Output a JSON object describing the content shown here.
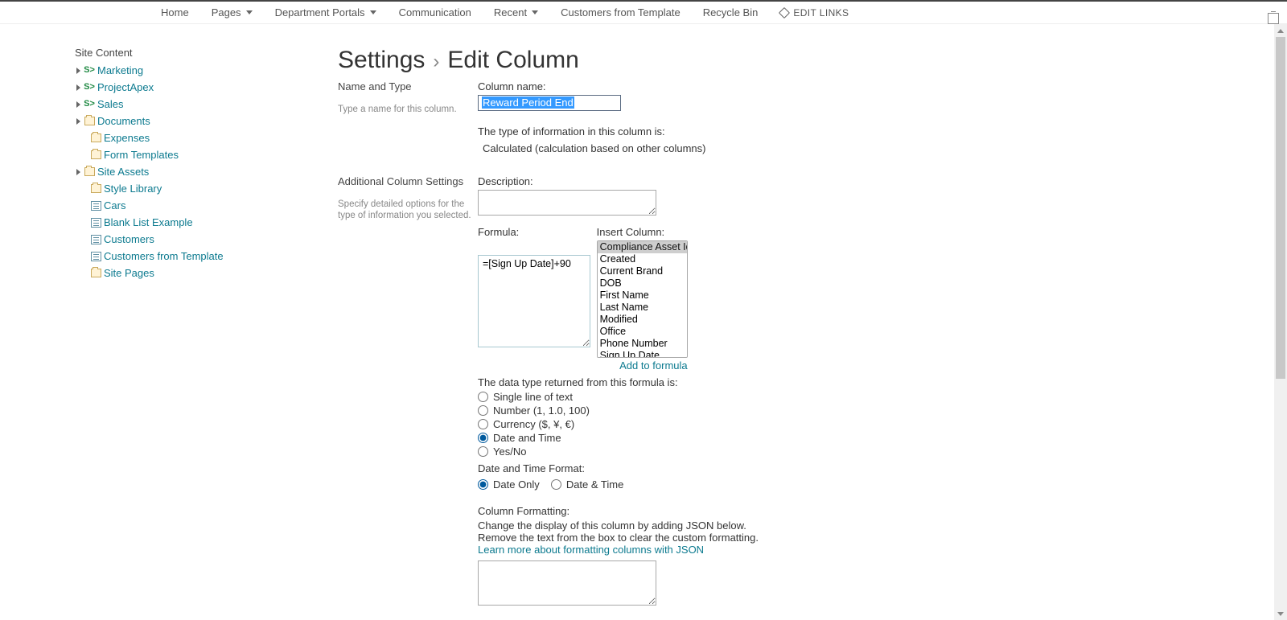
{
  "topnav": {
    "items": [
      {
        "label": "Home",
        "dropdown": false
      },
      {
        "label": "Pages",
        "dropdown": true
      },
      {
        "label": "Department Portals",
        "dropdown": true
      },
      {
        "label": "Communication",
        "dropdown": false
      },
      {
        "label": "Recent",
        "dropdown": true
      },
      {
        "label": "Customers from Template",
        "dropdown": false
      },
      {
        "label": "Recycle Bin",
        "dropdown": false
      }
    ],
    "edit_links": "EDIT LINKS"
  },
  "side": {
    "heading": "Site Content",
    "nodes": [
      {
        "label": "Marketing",
        "icon": "site",
        "toggle": true,
        "indent": 0
      },
      {
        "label": "ProjectApex",
        "icon": "site",
        "toggle": true,
        "indent": 0
      },
      {
        "label": "Sales",
        "icon": "site",
        "toggle": true,
        "indent": 0
      },
      {
        "label": "Documents",
        "icon": "folder",
        "toggle": true,
        "indent": 0
      },
      {
        "label": "Expenses",
        "icon": "folder",
        "toggle": false,
        "indent": 1
      },
      {
        "label": "Form Templates",
        "icon": "folder",
        "toggle": false,
        "indent": 1
      },
      {
        "label": "Site Assets",
        "icon": "folder",
        "toggle": true,
        "indent": 0
      },
      {
        "label": "Style Library",
        "icon": "folder",
        "toggle": false,
        "indent": 1
      },
      {
        "label": "Cars",
        "icon": "list",
        "toggle": false,
        "indent": 1
      },
      {
        "label": "Blank List Example",
        "icon": "list",
        "toggle": false,
        "indent": 1
      },
      {
        "label": "Customers",
        "icon": "list",
        "toggle": false,
        "indent": 1
      },
      {
        "label": "Customers from Template",
        "icon": "list",
        "toggle": false,
        "indent": 1
      },
      {
        "label": "Site Pages",
        "icon": "folder",
        "toggle": false,
        "indent": 1
      }
    ]
  },
  "breadcrumb": {
    "settings": "Settings",
    "page": "Edit Column"
  },
  "section_name": {
    "title": "Name and Type",
    "desc": "Type a name for this column.",
    "col_name_label": "Column name:",
    "col_name_value": "Reward Period End",
    "type_line": "The type of information in this column is:",
    "type_value": "Calculated (calculation based on other columns)"
  },
  "section_addl": {
    "title": "Additional Column Settings",
    "desc": "Specify detailed options for the type of information you selected.",
    "description_label": "Description:",
    "description_value": "",
    "formula_label": "Formula:",
    "formula_value": "=[Sign Up Date]+90",
    "insert_label": "Insert Column:",
    "insert_options": [
      "Compliance Asset Id",
      "Created",
      "Current Brand",
      "DOB",
      "First Name",
      "Last Name",
      "Modified",
      "Office",
      "Phone Number",
      "Sign Up Date"
    ],
    "insert_selected": "Compliance Asset Id",
    "add_to_formula": "Add to formula",
    "data_type_line": "The data type returned from this formula is:",
    "dt_options": [
      {
        "label": "Single line of text",
        "checked": false
      },
      {
        "label": "Number (1, 1.0, 100)",
        "checked": false
      },
      {
        "label": "Currency ($, ¥, €)",
        "checked": false
      },
      {
        "label": "Date and Time",
        "checked": true
      },
      {
        "label": "Yes/No",
        "checked": false
      }
    ],
    "dt_format_label": "Date and Time Format:",
    "dt_format": [
      {
        "label": "Date Only",
        "checked": true
      },
      {
        "label": "Date & Time",
        "checked": false
      }
    ],
    "col_fmt_label": "Column Formatting:",
    "col_fmt_line1": "Change the display of this column by adding JSON below.",
    "col_fmt_line2": "Remove the text from the box to clear the custom formatting.",
    "col_fmt_link": "Learn more about formatting columns with JSON"
  }
}
